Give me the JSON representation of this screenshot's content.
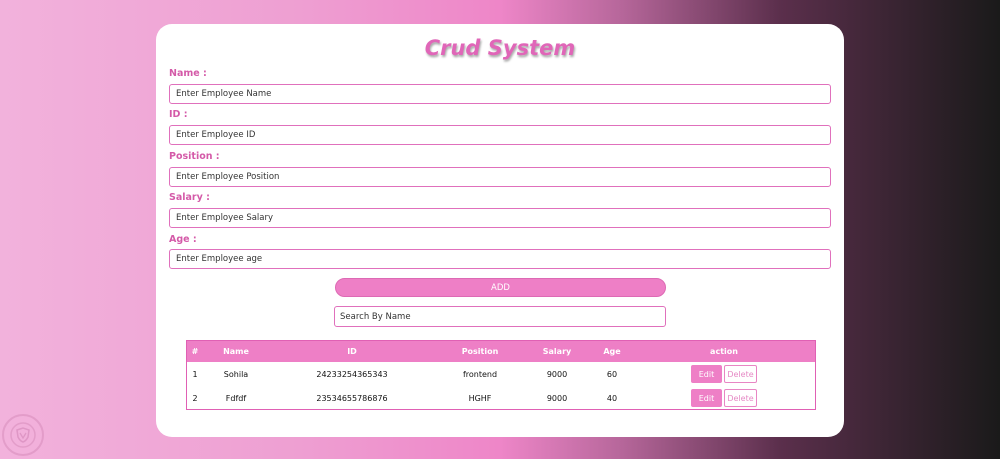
{
  "app": {
    "title": "Crud System"
  },
  "form": {
    "fields": [
      {
        "label": "Name :",
        "placeholder": "Enter Employee Name"
      },
      {
        "label": "ID :",
        "placeholder": "Enter Employee ID"
      },
      {
        "label": "Position :",
        "placeholder": "Enter Employee Position"
      },
      {
        "label": "Salary :",
        "placeholder": "Enter Employee Salary"
      },
      {
        "label": "Age :",
        "placeholder": "Enter Employee age"
      }
    ],
    "add_label": "ADD",
    "search_placeholder": "Search By Name"
  },
  "table": {
    "headers": [
      "#",
      "Name",
      "ID",
      "Position",
      "Salary",
      "Age",
      "action"
    ],
    "rows": [
      {
        "num": "1",
        "name": "Sohila",
        "id": "24233254365343",
        "position": "frontend",
        "salary": "9000",
        "age": "60"
      },
      {
        "num": "2",
        "name": "Fdfdf",
        "id": "23534655786876",
        "position": "HGHF",
        "salary": "9000",
        "age": "40"
      }
    ],
    "edit_label": "Edit",
    "delete_label": "Delete"
  },
  "colors": {
    "accent": "#ee7fc6",
    "label": "#d45aa8"
  },
  "icons": {
    "logo": "shield-logo-icon"
  }
}
